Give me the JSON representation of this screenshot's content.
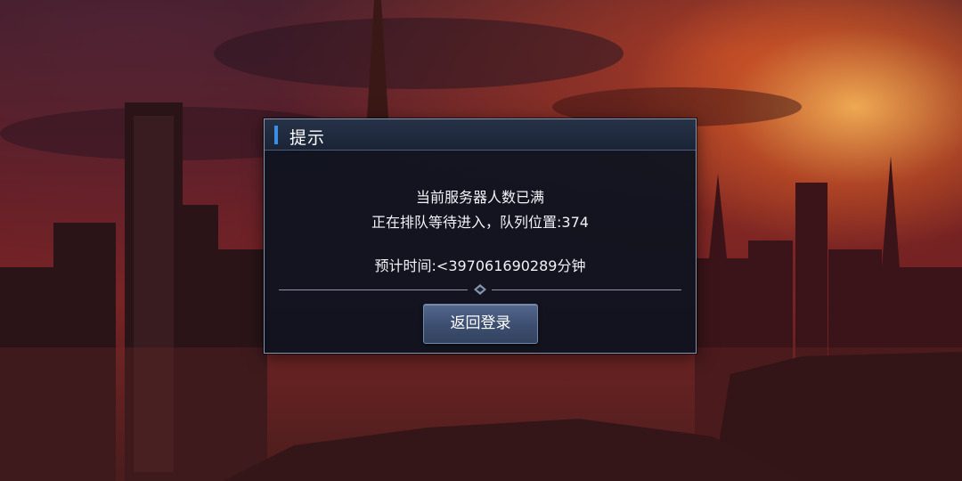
{
  "dialog": {
    "title": "提示",
    "line1": "当前服务器人数已满",
    "line2": "正在排队等待进入，队列位置:374",
    "line3": "预计时间:<397061690289分钟",
    "return_button_label": "返回登录"
  }
}
